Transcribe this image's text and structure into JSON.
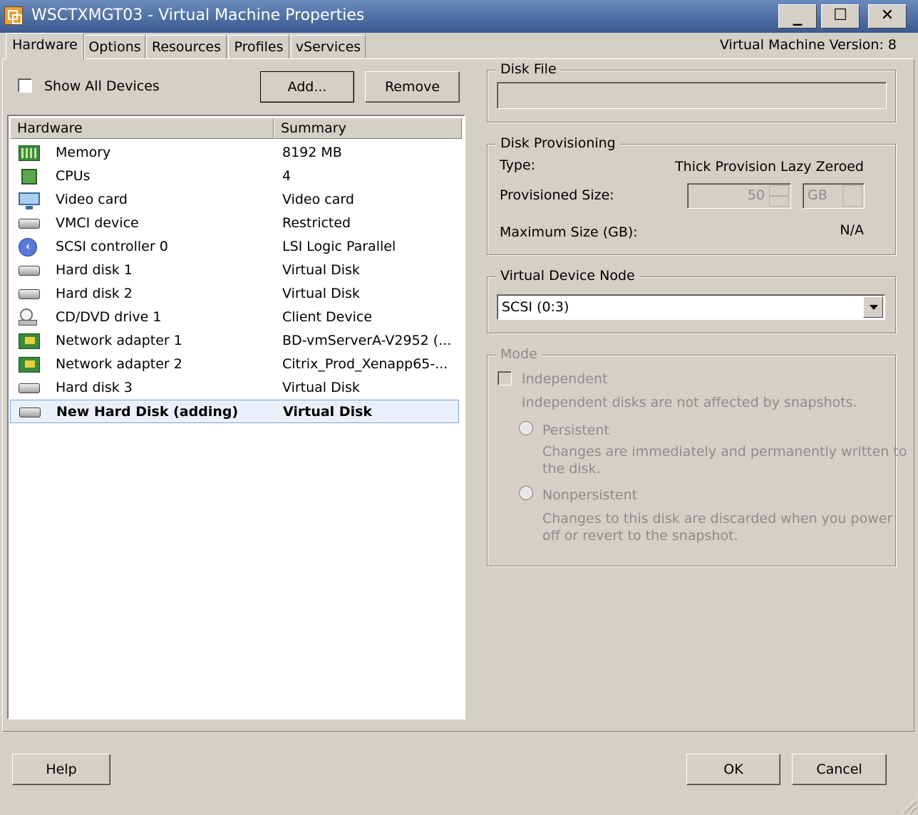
{
  "window": {
    "title": "WSCTXMGT03 - Virtual Machine Properties",
    "minimize_glyph": "_",
    "maximize_glyph": "☐",
    "close_glyph": "✕"
  },
  "tabs": [
    {
      "label": "Hardware",
      "active": true
    },
    {
      "label": "Options"
    },
    {
      "label": "Resources"
    },
    {
      "label": "Profiles"
    },
    {
      "label": "vServices"
    }
  ],
  "vm_version": "Virtual Machine Version: 8",
  "left": {
    "show_all_devices_label": "Show All Devices",
    "show_all_devices_checked": false,
    "add_label": "Add...",
    "remove_label": "Remove"
  },
  "hardware_table": {
    "columns": [
      "Hardware",
      "Summary"
    ],
    "rows": [
      {
        "icon": "memory-icon",
        "name": "Memory",
        "summary": "8192 MB"
      },
      {
        "icon": "cpu-icon",
        "name": "CPUs",
        "summary": "4"
      },
      {
        "icon": "monitor-icon",
        "name": "Video card",
        "summary": "Video card"
      },
      {
        "icon": "device-icon",
        "name": "VMCI device",
        "summary": "Restricted"
      },
      {
        "icon": "scsi-controller-icon",
        "name": "SCSI controller 0",
        "summary": "LSI Logic Parallel"
      },
      {
        "icon": "hard-disk-icon",
        "name": "Hard disk 1",
        "summary": "Virtual Disk"
      },
      {
        "icon": "hard-disk-icon",
        "name": "Hard disk 2",
        "summary": "Virtual Disk"
      },
      {
        "icon": "cd-dvd-icon",
        "name": "CD/DVD drive 1",
        "summary": "Client Device"
      },
      {
        "icon": "network-adapter-icon",
        "name": "Network adapter 1",
        "summary": "BD-vmServerA-V2952 (..."
      },
      {
        "icon": "network-adapter-icon",
        "name": "Network adapter 2",
        "summary": "Citrix_Prod_Xenapp65-..."
      },
      {
        "icon": "hard-disk-icon",
        "name": "Hard disk 3",
        "summary": "Virtual Disk"
      },
      {
        "icon": "hard-disk-icon",
        "name": "New Hard Disk (adding)",
        "summary": "Virtual Disk",
        "selected": true
      }
    ]
  },
  "disk_file": {
    "legend": "Disk File",
    "value": ""
  },
  "disk_provisioning": {
    "legend": "Disk Provisioning",
    "type_label": "Type:",
    "type_value": "Thick Provision Lazy Zeroed",
    "provisioned_size_label": "Provisioned Size:",
    "provisioned_size_value": "50",
    "provisioned_size_unit": "GB",
    "maximum_size_label": "Maximum Size (GB):",
    "maximum_size_value": "N/A"
  },
  "virtual_device_node": {
    "legend": "Virtual Device Node",
    "value": "SCSI (0:3)"
  },
  "mode": {
    "legend": "Mode",
    "independent_label": "Independent",
    "independent_desc": "Independent disks are not affected by snapshots.",
    "persistent_label": "Persistent",
    "persistent_desc_1": "Changes are immediately and permanently written to",
    "persistent_desc_2": "the disk.",
    "nonpersistent_label": "Nonpersistent",
    "nonpersistent_desc_1": "Changes to this disk are discarded when you power",
    "nonpersistent_desc_2": "off or revert to the snapshot."
  },
  "footer": {
    "help_label": "Help",
    "ok_label": "OK",
    "cancel_label": "Cancel"
  }
}
